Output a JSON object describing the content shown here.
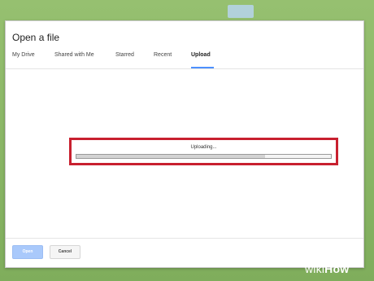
{
  "dialog": {
    "title": "Open a file"
  },
  "tabs": [
    {
      "label": "My Drive",
      "active": false
    },
    {
      "label": "Shared with Me",
      "active": false
    },
    {
      "label": "Starred",
      "active": false
    },
    {
      "label": "Recent",
      "active": false
    },
    {
      "label": "Upload",
      "active": true
    }
  ],
  "upload": {
    "status": "Uploading...",
    "progress_fraction": 0.74
  },
  "footer": {
    "open_label": "Open",
    "cancel_label": "Cancel"
  },
  "branding": {
    "part1": "wiki",
    "part2": "How"
  },
  "colors": {
    "background": "#8fb96b",
    "accent": "#4d90fe",
    "highlight_border": "#c8202f",
    "open_button": "#a9c9fb"
  }
}
